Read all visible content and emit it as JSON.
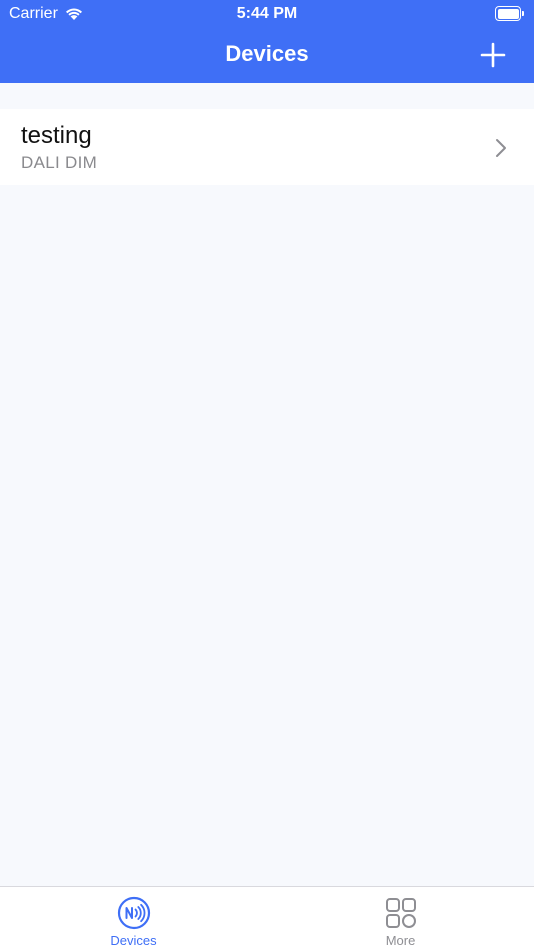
{
  "status_bar": {
    "carrier": "Carrier",
    "time": "5:44 PM"
  },
  "nav": {
    "title": "Devices",
    "add_icon": "plus-icon"
  },
  "devices": [
    {
      "name": "testing",
      "type": "DALI DIM"
    }
  ],
  "tab_bar": {
    "tabs": [
      {
        "label": "Devices",
        "icon": "nfc-icon",
        "selected": true
      },
      {
        "label": "More",
        "icon": "grid-icon",
        "selected": false
      }
    ]
  },
  "colors": {
    "accent": "#3f6ff6",
    "background": "#f7f9fd",
    "secondary_text": "#8a8a8e"
  }
}
